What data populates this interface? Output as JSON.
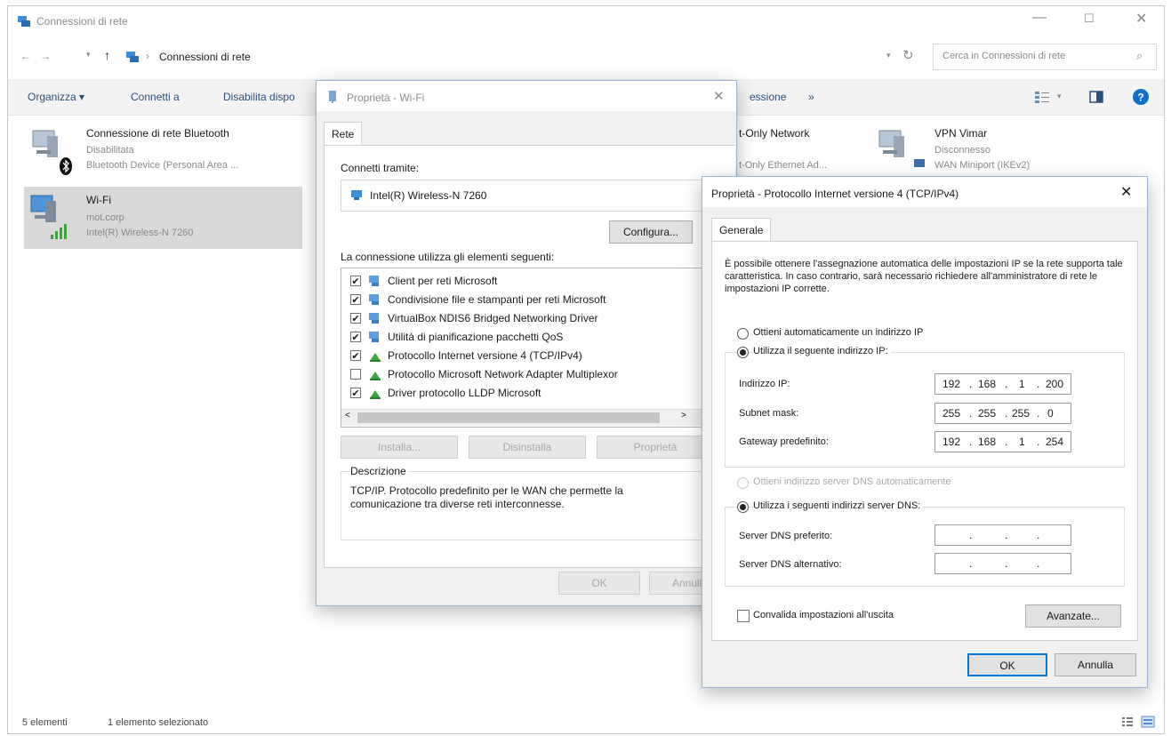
{
  "window": {
    "title": "Connessioni di rete",
    "breadcrumb": "Connessioni di rete",
    "search_placeholder": "Cerca in Connessioni di rete"
  },
  "toolbar": {
    "organize": "Organizza ▾",
    "connect": "Connetti a",
    "disable": "Disabilita dispo",
    "more": "essione",
    "more_arrow": "»"
  },
  "network_items": [
    {
      "name": "Connessione di rete Bluetooth",
      "status": "Disabilitata",
      "device": "Bluetooth Device (Personal Area ..."
    },
    {
      "name": "Wi-Fi",
      "status": "mot.corp",
      "device": "Intel(R) Wireless-N 7260"
    },
    {
      "name": "t-Only Network",
      "status": "",
      "device": "t-Only Ethernet Ad..."
    },
    {
      "name": "VPN Vimar",
      "status": "Disconnesso",
      "device": "WAN Miniport (IKEv2)"
    }
  ],
  "statusbar": {
    "count": "5 elementi",
    "selected": "1 elemento selezionato"
  },
  "wifi_dialog": {
    "title": "Proprietà - Wi-Fi",
    "tab": "Rete",
    "connect_using_label": "Connetti tramite:",
    "adapter": "Intel(R) Wireless-N 7260",
    "configure_button": "Configura...",
    "items_label": "La connessione utilizza gli elementi seguenti:",
    "components": [
      {
        "label": "Client per reti Microsoft",
        "checked": true
      },
      {
        "label": "Condivisione file e stampanti per reti Microsoft",
        "checked": true
      },
      {
        "label": "VirtualBox NDIS6 Bridged Networking Driver",
        "checked": true
      },
      {
        "label": "Utilità di pianificazione pacchetti QoS",
        "checked": true
      },
      {
        "label": "Protocollo Internet versione 4 (TCP/IPv4)",
        "checked": true
      },
      {
        "label": "Protocollo Microsoft Network Adapter Multiplexor",
        "checked": false
      },
      {
        "label": "Driver protocollo LLDP Microsoft",
        "checked": true
      }
    ],
    "install_button": "Installa...",
    "uninstall_button": "Disinstalla",
    "properties_button": "Proprietà",
    "description_title": "Descrizione",
    "description_text": "TCP/IP. Protocollo predefinito per le WAN che permette la comunicazione tra diverse reti interconnesse.",
    "ok_button": "OK",
    "cancel_button": "Annulla"
  },
  "ipv4_dialog": {
    "title": "Proprietà - Protocollo Internet versione 4 (TCP/IPv4)",
    "tab": "Generale",
    "intro": "È possibile ottenere l'assegnazione automatica delle impostazioni IP se la rete supporta tale caratteristica. In caso contrario, sarà necessario richiedere all'amministratore di rete le impostazioni IP corrette.",
    "auto_ip_label": "Ottieni automaticamente un indirizzo IP",
    "manual_ip_label": "Utilizza il seguente indirizzo IP:",
    "ip_label": "Indirizzo IP:",
    "ip_value": [
      "192",
      "168",
      "1",
      "200"
    ],
    "mask_label": "Subnet mask:",
    "mask_value": [
      "255",
      "255",
      "255",
      "0"
    ],
    "gateway_label": "Gateway predefinito:",
    "gateway_value": [
      "192",
      "168",
      "1",
      "254"
    ],
    "auto_dns_label": "Ottieni indirizzo server DNS automaticamente",
    "manual_dns_label": "Utilizza i seguenti indirizzi server DNS:",
    "dns_pref_label": "Server DNS preferito:",
    "dns_alt_label": "Server DNS alternativo:",
    "validate_label": "Convalida impostazioni all'uscita",
    "advanced_button": "Avanzate...",
    "ok_button": "OK",
    "cancel_button": "Annulla"
  },
  "colors": {
    "selection": "#d9d9d9",
    "accent_blue": "#0078d7"
  }
}
